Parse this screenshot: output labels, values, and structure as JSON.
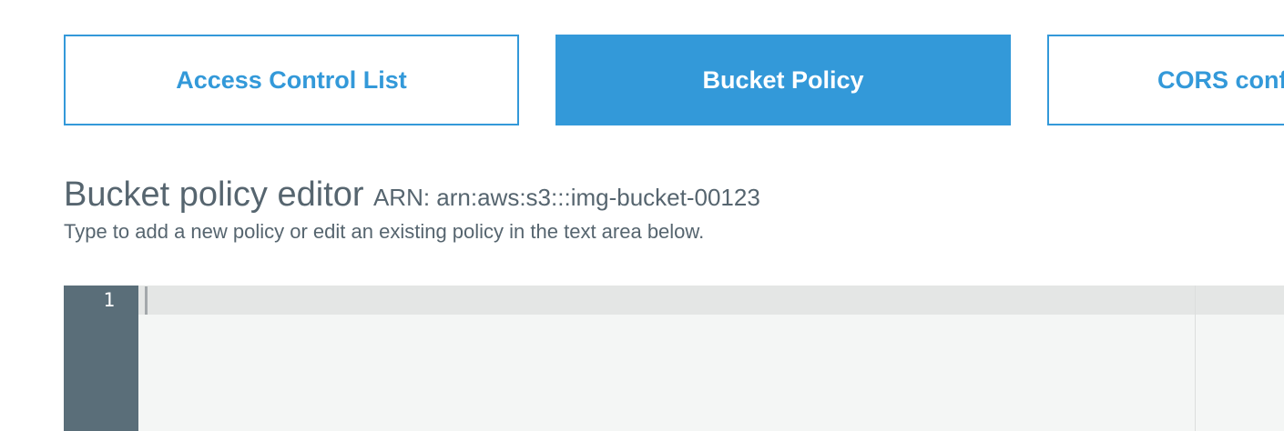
{
  "tabs": [
    {
      "label": "Access Control List",
      "active": false
    },
    {
      "label": "Bucket Policy",
      "active": true
    },
    {
      "label": "CORS configuration",
      "active": false
    }
  ],
  "editor_heading": {
    "title": "Bucket policy editor",
    "arn": "ARN: arn:aws:s3:::img-bucket-00123",
    "subtitle": "Type to add a new policy or edit an existing policy in the text area below."
  },
  "editor": {
    "line_numbers": [
      "1"
    ],
    "content": ""
  },
  "colors": {
    "accent": "#3399d9",
    "gutter": "#5a6e79",
    "text": "#56656f"
  }
}
